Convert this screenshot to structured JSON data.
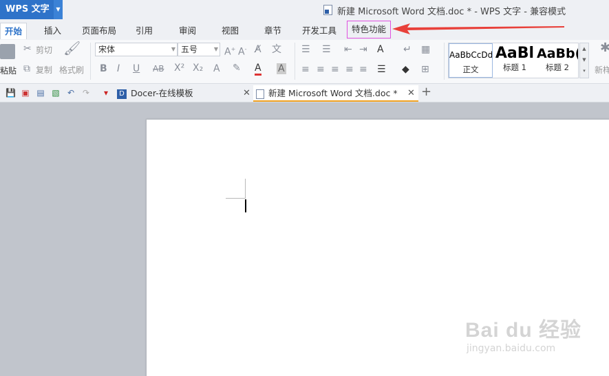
{
  "app": {
    "name": "WPS 文字",
    "window_title": "新建 Microsoft Word 文档.doc * - WPS 文字 - 兼容模式"
  },
  "menu": {
    "tabs": [
      {
        "label": "开始",
        "active": true
      },
      {
        "label": "插入"
      },
      {
        "label": "页面布局"
      },
      {
        "label": "引用"
      },
      {
        "label": "审阅"
      },
      {
        "label": "视图"
      },
      {
        "label": "章节"
      },
      {
        "label": "开发工具"
      },
      {
        "label": "特色功能",
        "highlighted": true
      }
    ]
  },
  "ribbon": {
    "paste_label": "粘贴",
    "cut_label": "剪切",
    "copy_label": "复制",
    "format_painter_label": "格式刷",
    "font_name": "宋体",
    "font_size": "五号",
    "styles": [
      {
        "sample": "AaBbCcDd",
        "label": "正文"
      },
      {
        "sample": "AaBl",
        "label": "标题 1"
      },
      {
        "sample": "AaBb(",
        "label": "标题 2"
      }
    ],
    "new_style_label": "新样"
  },
  "doc_tabs": [
    {
      "label": "Docer-在线模板"
    },
    {
      "label": "新建 Microsoft Word 文档.doc *",
      "active": true
    }
  ],
  "watermark": {
    "main": "Bai du 经验",
    "sub": "jingyan.baidu.com"
  },
  "colors": {
    "accent": "#2e73c9",
    "highlight_border": "#e050e0",
    "arrow": "#e8403a",
    "active_tab_underline": "#f0a020"
  }
}
